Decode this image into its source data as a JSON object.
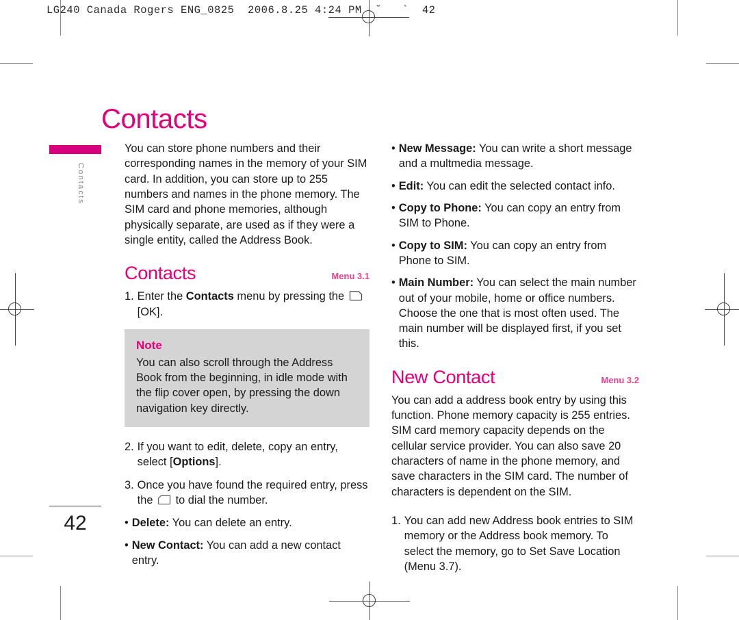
{
  "print_header": "LG240 Canada Rogers ENG_0825  2006.8.25 4:24 PM  ˘   `  42",
  "page_title": "Contacts",
  "margin_tab_label": "Contacts",
  "page_number": "42",
  "colors": {
    "accent_magenta": "#E2007A",
    "tab_magenta": "#D6007F",
    "menu_ref_pink": "#E8458F",
    "note_background": "#D4D4D4",
    "body_text": "#1a1a1a",
    "tab_label_gray": "#808080"
  },
  "left_column": {
    "intro": "You can store phone numbers and their corresponding names in the memory of your SIM card. In addition, you can store up to 255 numbers and names in the phone memory. The SIM card and phone memories, although physically separate, are used as if they were a single entity, called the Address Book.",
    "section": {
      "title": "Contacts",
      "menu_ref": "Menu 3.1"
    },
    "step1": {
      "marker": "1.",
      "text_before": "Enter the ",
      "bold": "Contacts",
      "text_after": " menu by pressing the ",
      "icon": "ok-key-icon",
      "text_end": " [OK]."
    },
    "note": {
      "title": "Note",
      "text": "You can also scroll through the Address Book from the beginning, in idle mode with the flip cover open, by pressing the down navigation key directly."
    },
    "step2": {
      "marker": "2.",
      "text_before": "If you want to edit, delete, copy an entry, select [",
      "bold": "Options",
      "text_after": "]."
    },
    "step3": {
      "marker": "3.",
      "text_before": "Once you have found the required entry, press the ",
      "icon": "send-key-icon",
      "text_after": " to dial the number."
    },
    "bullets": [
      {
        "dot": "•",
        "bold": "Delete:",
        "text": " You can delete an entry."
      },
      {
        "dot": "•",
        "bold": "New Contact:",
        "text": " You can add a new contact entry."
      }
    ]
  },
  "right_column": {
    "bullets": [
      {
        "dot": "•",
        "bold": "New Message:",
        "text": " You can write a short message and a multmedia message."
      },
      {
        "dot": "•",
        "bold": "Edit:",
        "text": " You can edit the selected contact info."
      },
      {
        "dot": "•",
        "bold": "Copy to Phone:",
        "text": " You can copy an entry from SIM to Phone."
      },
      {
        "dot": "•",
        "bold": "Copy to SIM:",
        "text": " You can copy an entry from Phone to SIM."
      },
      {
        "dot": "•",
        "bold": "Main Number:",
        "text": " You can select the main number out of your mobile, home or office numbers. Choose the one that is most often used. The main number will be displayed first, if you set this."
      }
    ],
    "section": {
      "title": "New Contact",
      "menu_ref": "Menu 3.2"
    },
    "paragraph": "You can add a address book entry by using this function. Phone memory capacity is 255 entries. SIM card memory capacity depends on the cellular service provider. You can also save 20 characters of name in the phone memory, and save characters in the SIM card. The number of characters is dependent on the SIM.",
    "step1": {
      "marker": "1.",
      "text": "You can add new Address book entries to SIM memory or the Address book memory. To select the memory, go to Set Save Location (Menu 3.7)."
    }
  }
}
